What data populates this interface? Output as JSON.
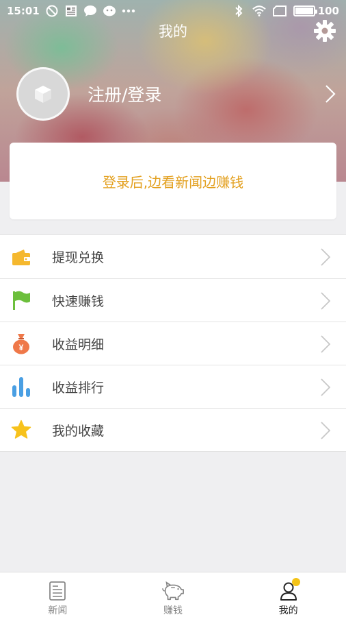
{
  "status_bar": {
    "time": "15:01",
    "battery_level": "100",
    "icons_left": [
      "do-not-disturb-icon",
      "news-app-icon",
      "chat-bubble-icon",
      "wechat-icon",
      "more-dots-icon"
    ],
    "icons_right": [
      "bluetooth-icon",
      "wifi-icon",
      "sim-icon",
      "battery-icon"
    ]
  },
  "header": {
    "title": "我的"
  },
  "profile": {
    "login_label": "注册/登录"
  },
  "promo": {
    "text": "登录后,边看新闻边赚钱"
  },
  "menu": {
    "items": [
      {
        "label": "提现兑换",
        "icon": "wallet-icon"
      },
      {
        "label": "快速赚钱",
        "icon": "flag-icon"
      },
      {
        "label": "收益明细",
        "icon": "money-bag-icon"
      },
      {
        "label": "收益排行",
        "icon": "bar-chart-icon"
      },
      {
        "label": "我的收藏",
        "icon": "star-icon"
      }
    ]
  },
  "bottom_nav": {
    "tabs": [
      {
        "label": "新闻",
        "icon": "newspaper-icon",
        "active": false
      },
      {
        "label": "赚钱",
        "icon": "piggy-bank-icon",
        "active": false
      },
      {
        "label": "我的",
        "icon": "user-icon",
        "active": true
      }
    ]
  },
  "colors": {
    "accent_orange": "#e3a01f",
    "wallet_yellow": "#f5b82e",
    "flag_green": "#6cbf3c",
    "bag_orange": "#ef7849",
    "chart_blue": "#4a9fe3",
    "star_yellow": "#f7c21c",
    "badge_yellow": "#f4c317"
  }
}
